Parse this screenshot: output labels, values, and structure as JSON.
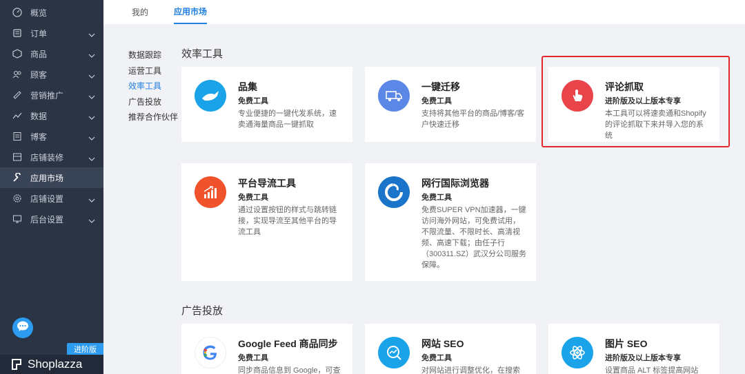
{
  "sidebar": {
    "items": [
      {
        "label": "概览",
        "icon": "dashboard-icon"
      },
      {
        "label": "订单",
        "icon": "order-icon"
      },
      {
        "label": "商品",
        "icon": "product-icon"
      },
      {
        "label": "顾客",
        "icon": "customer-icon"
      },
      {
        "label": "营销推广",
        "icon": "marketing-icon"
      },
      {
        "label": "数据",
        "icon": "data-icon"
      },
      {
        "label": "博客",
        "icon": "blog-icon"
      },
      {
        "label": "店铺装修",
        "icon": "store-design-icon"
      },
      {
        "label": "应用市场",
        "icon": "wrench-icon"
      },
      {
        "label": "店铺设置",
        "icon": "gear-icon"
      },
      {
        "label": "后台设置",
        "icon": "monitor-icon"
      }
    ],
    "badge": "进阶版",
    "brand": "Shoplazza"
  },
  "tabs": {
    "mine": "我的",
    "market": "应用市场"
  },
  "submenu": [
    "数据跟踪",
    "运营工具",
    "效率工具",
    "广告投放",
    "推荐合作伙伴"
  ],
  "sections": {
    "efficiency": "效率工具",
    "ads": "广告投放"
  },
  "cards": [
    {
      "title": "品集",
      "tier": "免费工具",
      "desc": "专业便捷的一键代发系统，速卖通海量商品一键抓取",
      "icon": "whale-icon",
      "color": "#1aa3e8"
    },
    {
      "title": "一键迁移",
      "tier": "免费工具",
      "desc": "支持将其他平台的商品/博客/客户快速迁移",
      "icon": "truck-icon",
      "color": "#5b87e6"
    },
    {
      "title": "评论抓取",
      "tier": "进阶版及以上版本专享",
      "desc": "本工具可以将速卖通和Shopify的评论抓取下来并导入您的系统",
      "icon": "hand-pointer-icon",
      "color": "#e8444a"
    },
    {
      "title": "平台导流工具",
      "tier": "免费工具",
      "desc": "通过设置按钮的样式与跳转链接，实现导流至其他平台的导流工具",
      "icon": "growth-chart-icon",
      "color": "#f0532c"
    },
    {
      "title": "网行国际浏览器",
      "tier": "免费工具",
      "desc": "免费SUPER VPN加速器，一键访问海外网站，可免费试用，不限流量、不限时长、高清视频、高速下载；由任子行（300311.SZ）武汉分公司服务保障。",
      "icon": "browser-logo-icon",
      "color": "#1a74c9"
    },
    {
      "title": "Google Feed 商品同步",
      "tier": "免费工具",
      "desc": "同步商品信息到 Google，可查",
      "icon": "google-icon",
      "color": "#ffffff"
    },
    {
      "title": "网站 SEO",
      "tier": "免费工具",
      "desc": "对网站进行调整优化，在搜索引",
      "icon": "seo-search-icon",
      "color": "#1aa3e8"
    },
    {
      "title": "图片 SEO",
      "tier": "进阶版及以上版本专享",
      "desc": "设置商品 ALT 标签提高网站",
      "icon": "atom-icon",
      "color": "#1aa3e8"
    }
  ]
}
